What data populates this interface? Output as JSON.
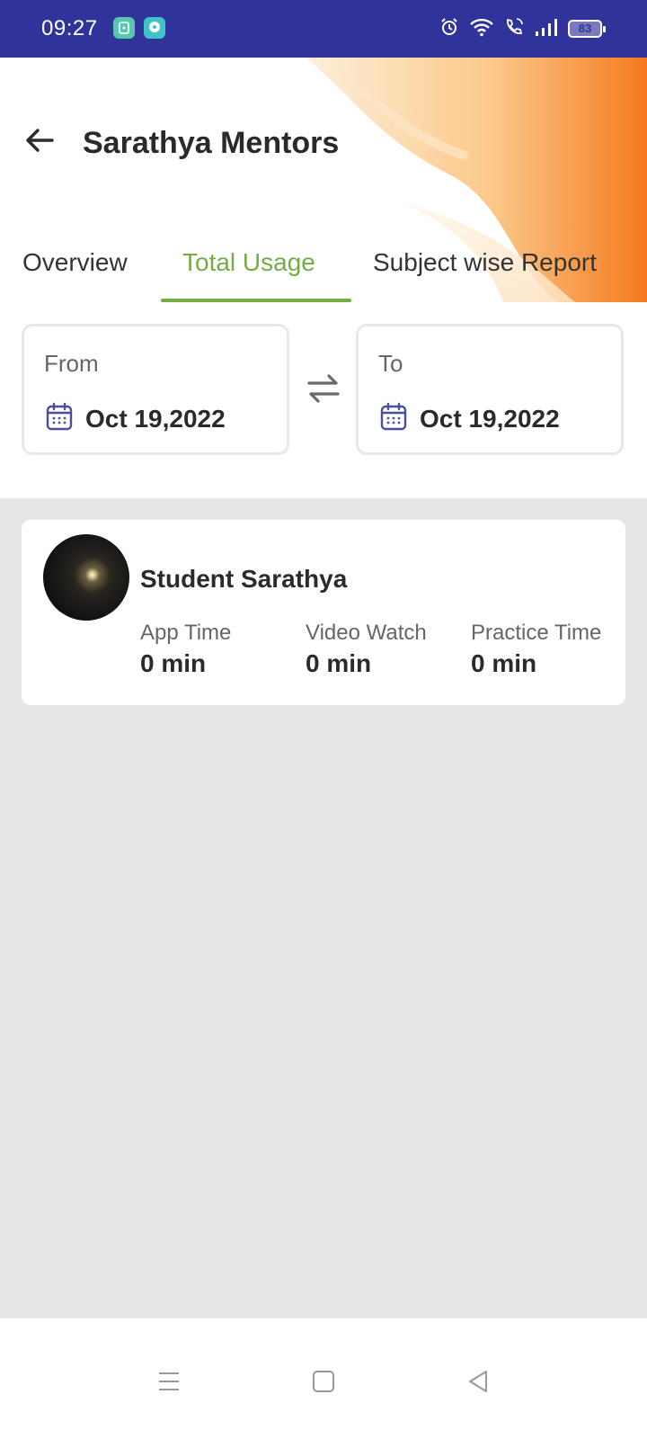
{
  "status_bar": {
    "time": "09:27",
    "battery": "83",
    "icons": [
      "app-notification-icon",
      "chat-notification-icon",
      "alarm-icon",
      "wifi-icon",
      "wifi-calling-icon",
      "signal-icon",
      "battery-icon"
    ]
  },
  "header": {
    "title": "Sarathya Mentors",
    "back_icon": "arrow-left-icon",
    "accent_color": "#f47b20"
  },
  "tabs": [
    {
      "label": "Overview",
      "active": false
    },
    {
      "label": "Total Usage",
      "active": true
    },
    {
      "label": "Subject wise Report",
      "active": false
    }
  ],
  "tab_active_color": "#73ad44",
  "date_range": {
    "from": {
      "label": "From",
      "value": "Oct 19,2022",
      "icon": "calendar-icon"
    },
    "to": {
      "label": "To",
      "value": "Oct 19,2022",
      "icon": "calendar-icon"
    },
    "swap_icon": "swap-arrows-icon"
  },
  "student": {
    "name": "Student Sarathya",
    "stats": [
      {
        "label": "App Time",
        "value": "0 min"
      },
      {
        "label": "Video Watch",
        "value": "0 min"
      },
      {
        "label": "Practice Time",
        "value": "0 min"
      }
    ]
  },
  "nav_bar": {
    "icons": [
      "menu-icon",
      "home-icon",
      "back-icon"
    ]
  }
}
